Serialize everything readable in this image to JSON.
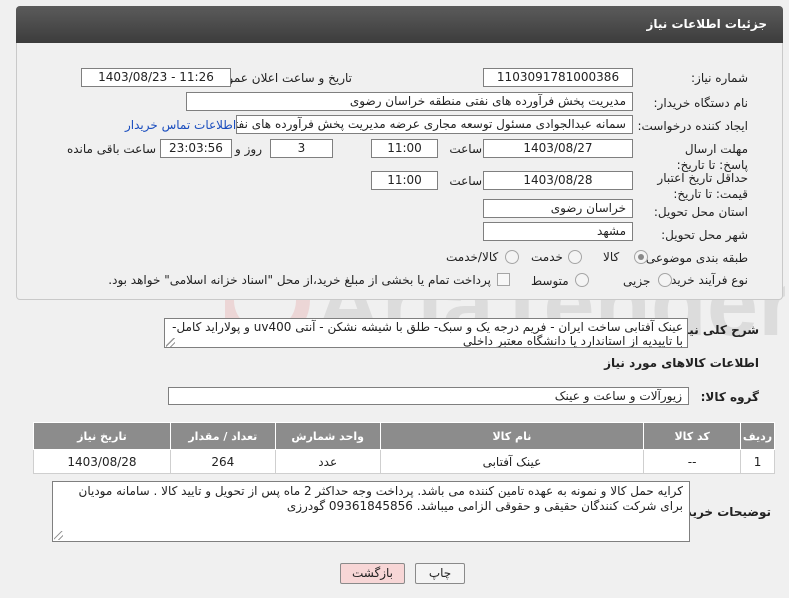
{
  "panel": {
    "title": "جزئیات اطلاعات نیاز"
  },
  "fields": {
    "need_number": {
      "label": "شماره نیاز:",
      "value": "1103091781000386"
    },
    "announce_datetime": {
      "label": "تاریخ و ساعت اعلان عمومی:",
      "value": "1403/08/23 - 11:26"
    },
    "buyer_org": {
      "label": "نام دستگاه خریدار:",
      "value": "مدیریت پخش فرآورده های نفتی منطقه خراسان رضوی"
    },
    "requester": {
      "label": "ایجاد کننده درخواست:",
      "value": "سمانه عبدالجوادی مسئول توسعه مجاری عرضه مدیریت پخش فرآورده های نفتی",
      "contact_link": "اطلاعات تماس خریدار"
    },
    "reply_deadline": {
      "label": "مهلت ارسال پاسخ: تا تاریخ:",
      "date": "1403/08/27",
      "time_label": "ساعت",
      "time": "11:00",
      "days": "3",
      "days_label": "روز و",
      "remaining": "23:03:56",
      "remaining_label": "ساعت باقی مانده"
    },
    "price_validity": {
      "label": "حداقل تاریخ اعتبار قیمت: تا تاریخ:",
      "date": "1403/08/28",
      "time_label": "ساعت",
      "time": "11:00"
    },
    "delivery_province": {
      "label": "استان محل تحویل:",
      "value": "خراسان رضوی"
    },
    "delivery_city": {
      "label": "شهر محل تحویل:",
      "value": "مشهد"
    },
    "category": {
      "label": "طبقه بندی موضوعی:",
      "options": [
        "کالا",
        "خدمت",
        "کالا/خدمت"
      ],
      "selected": "کالا"
    },
    "purchase_process": {
      "label": "نوع فرآیند خرید :",
      "options": [
        "جزیی",
        "متوسط"
      ],
      "checkbox_text": "پرداخت تمام یا بخشی از مبلغ خرید،از محل \"اسناد خزانه اسلامی\" خواهد بود."
    }
  },
  "summary": {
    "label": "شرح کلی نیاز:",
    "text": "عینک آفتابی ساخت ایران - فریم درجه یک و سبک- طلق با شیشه نشکن - آنتی uv400 و پولاراید کامل-با تاییدیه از استاندارد یا دانشگاه معتبر داخلی"
  },
  "goods_section": {
    "title": "اطلاعات کالاهای مورد نیاز"
  },
  "goods_group": {
    "label": "گروه کالا:",
    "value": "زیورآلات و ساعت و عینک"
  },
  "table": {
    "headers": [
      "ردیف",
      "کد کالا",
      "نام کالا",
      "واحد شمارش",
      "تعداد / مقدار",
      "تاریخ نیاز"
    ],
    "rows": [
      [
        "1",
        "--",
        "عینک آفتابی",
        "عدد",
        "264",
        "1403/08/28"
      ]
    ]
  },
  "buyer_notes": {
    "label": "توضیحات خریدار:",
    "text": "کرایه حمل کالا و نمونه به عهده تامین کننده می باشد. پرداخت وجه حداکثر 2 ماه پس از تحویل و تایید کالا . سامانه مودیان برای شرکت کنندگان حقیقی و حقوقی الزامی میباشد. 09361845856 گودرزی"
  },
  "buttons": {
    "print": "چاپ",
    "back": "بازگشت"
  },
  "watermark": {
    "text": "AriaTender.net"
  },
  "colors": {
    "header_bg": "#4a4a4a",
    "table_header_bg": "#8c8c8c",
    "link": "#1a4dbe",
    "back_button_bg": "#f7d6d6"
  }
}
